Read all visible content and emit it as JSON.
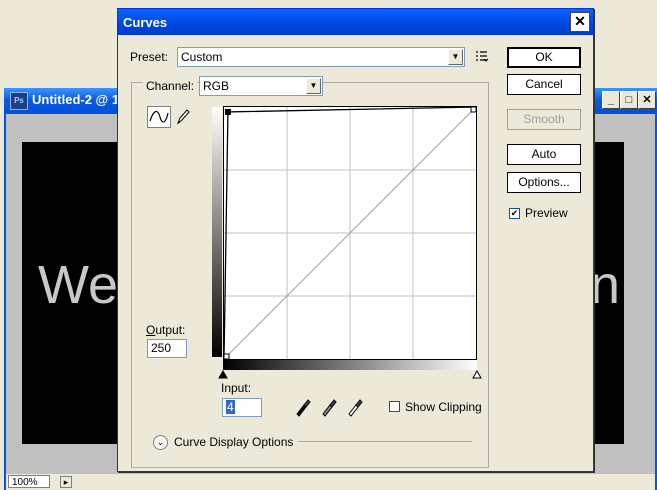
{
  "document_window": {
    "title": "Untitled-2 @ 1",
    "ps_icon_text": "Ps",
    "canvas_text_visible": "Wel",
    "canvas_text_tail": "n",
    "status_zoom": "100%"
  },
  "dialog": {
    "title": "Curves",
    "close_glyph": "✕",
    "preset": {
      "label": "Preset:",
      "value": "Custom"
    },
    "channel": {
      "label": "Channel:",
      "value": "RGB"
    },
    "output": {
      "label": "Output:",
      "value": "250"
    },
    "input": {
      "label": "Input:",
      "value": "4"
    },
    "buttons": {
      "ok": "OK",
      "cancel": "Cancel",
      "smooth": "Smooth",
      "auto": "Auto",
      "options": "Options..."
    },
    "preview": {
      "label": "Preview",
      "checked": true
    },
    "show_clipping": {
      "label": "Show Clipping",
      "checked": false
    },
    "curve_display_options": "Curve Display Options",
    "curve_points": [
      {
        "input": 0,
        "output": 0
      },
      {
        "input": 4,
        "output": 250
      },
      {
        "input": 255,
        "output": 255
      }
    ]
  }
}
